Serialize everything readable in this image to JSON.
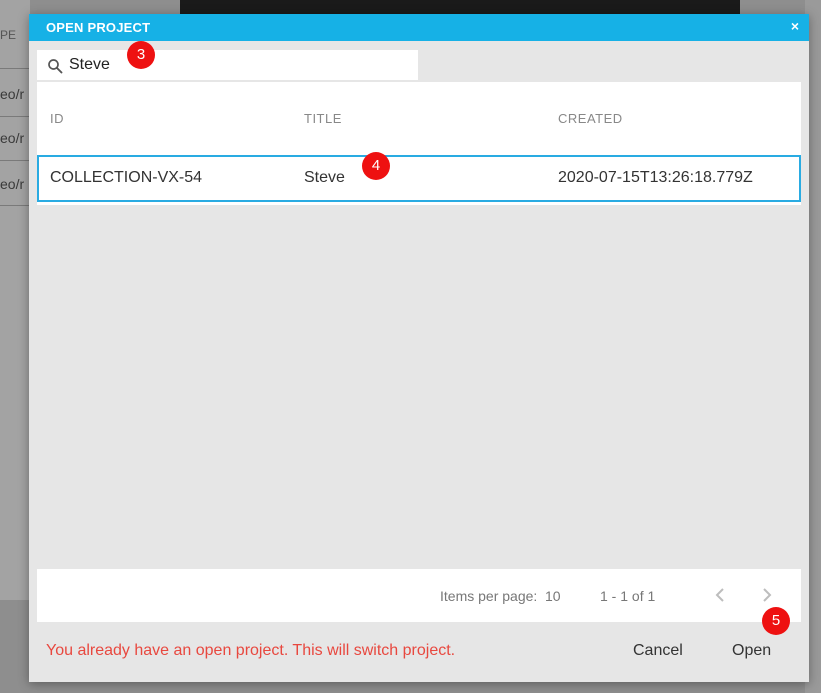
{
  "background": {
    "fragments": [
      "PE",
      "eo/r",
      "eo/r",
      "eo/r"
    ]
  },
  "dialog": {
    "title": "OPEN PROJECT",
    "close_glyph": "×",
    "search": {
      "value": "Steve",
      "icon": "search-icon"
    },
    "table": {
      "columns": [
        "ID",
        "TITLE",
        "CREATED"
      ],
      "rows": [
        {
          "id": "COLLECTION-VX-54",
          "title": "Steve",
          "created": "2020-07-15T13:26:18.779Z"
        }
      ]
    },
    "pagination": {
      "items_per_page_label": "Items per page:",
      "items_per_page_value": "10",
      "range": "1 - 1 of 1"
    },
    "warning": "You already have an open project. This will switch project.",
    "cancel_label": "Cancel",
    "open_label": "Open"
  },
  "markers": [
    "3",
    "4",
    "5"
  ],
  "colors": {
    "header": "#16b1e6",
    "selected_border": "#29abe2",
    "warning": "#e8483f",
    "marker": "#ee1111"
  }
}
